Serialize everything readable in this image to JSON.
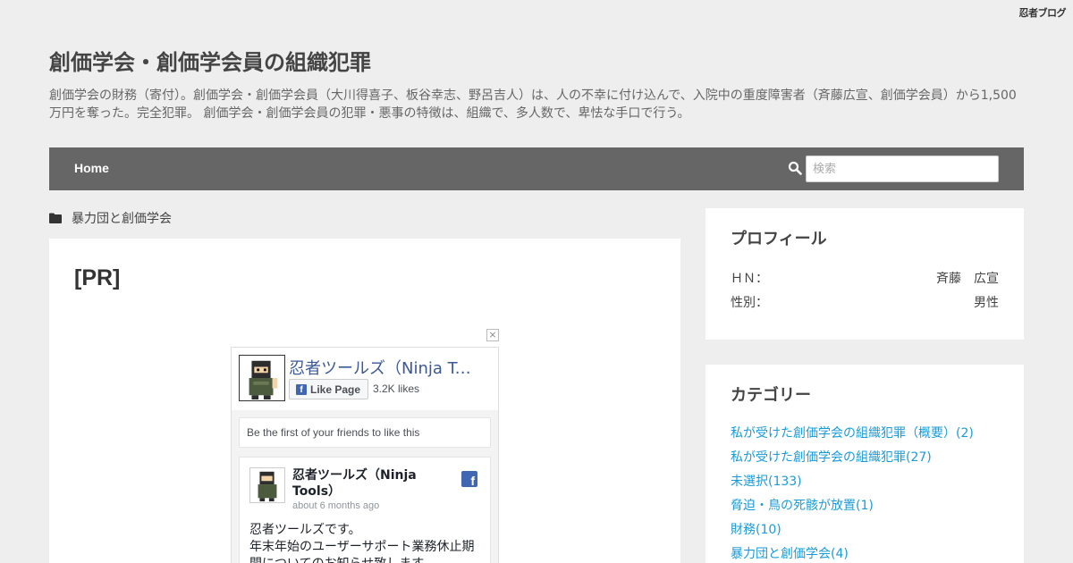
{
  "brand": "忍者ブログ",
  "site": {
    "title": "創価学会・創価学会員の組織犯罪",
    "description": "創価学会の財務（寄付）。創価学会・創価学会員（大川得喜子、板谷幸志、野呂吉人）は、人の不幸に付け込んで、入院中の重度障害者（斉藤広宣、創価学会員）から1,500万円を奪った。完全犯罪。 創価学会・創価学会員の犯罪・悪事の特徴は、組織で、多人数で、卑怯な手口で行う。"
  },
  "nav": {
    "home": "Home",
    "search_placeholder": "検索"
  },
  "breadcrumb": {
    "category": "暴力団と創価学会"
  },
  "main": {
    "title": "[PR]",
    "close": "×"
  },
  "fb": {
    "page_name": "忍者ツールズ（Ninja Tools）",
    "like_button": "Like Page",
    "like_count": "3.2K likes",
    "friends_text": "Be the first of your friends to like this",
    "post_name": "忍者ツールズ（Ninja Tools）",
    "post_time": "about 6 months ago",
    "post_text": "忍者ツールズです。\n年末年始のユーザーサポート業務休止期間についてのお知らせ致します。"
  },
  "profile": {
    "title": "プロフィール",
    "hn_label": "ＨＮ：",
    "hn_value": "斉藤　広宣",
    "gender_label": "性別：",
    "gender_value": "男性"
  },
  "categories": {
    "title": "カテゴリー",
    "items": [
      "私が受けた創価学会の組織犯罪（概要）(2)",
      "私が受けた創価学会の組織犯罪(27)",
      "未選択(133)",
      "脅迫・鳥の死骸が放置(1)",
      "財務(10)",
      "暴力団と創価学会(4)"
    ]
  },
  "colors": {
    "navbar": "#666666",
    "link": "#1a9bd7",
    "facebook": "#4267b2"
  }
}
